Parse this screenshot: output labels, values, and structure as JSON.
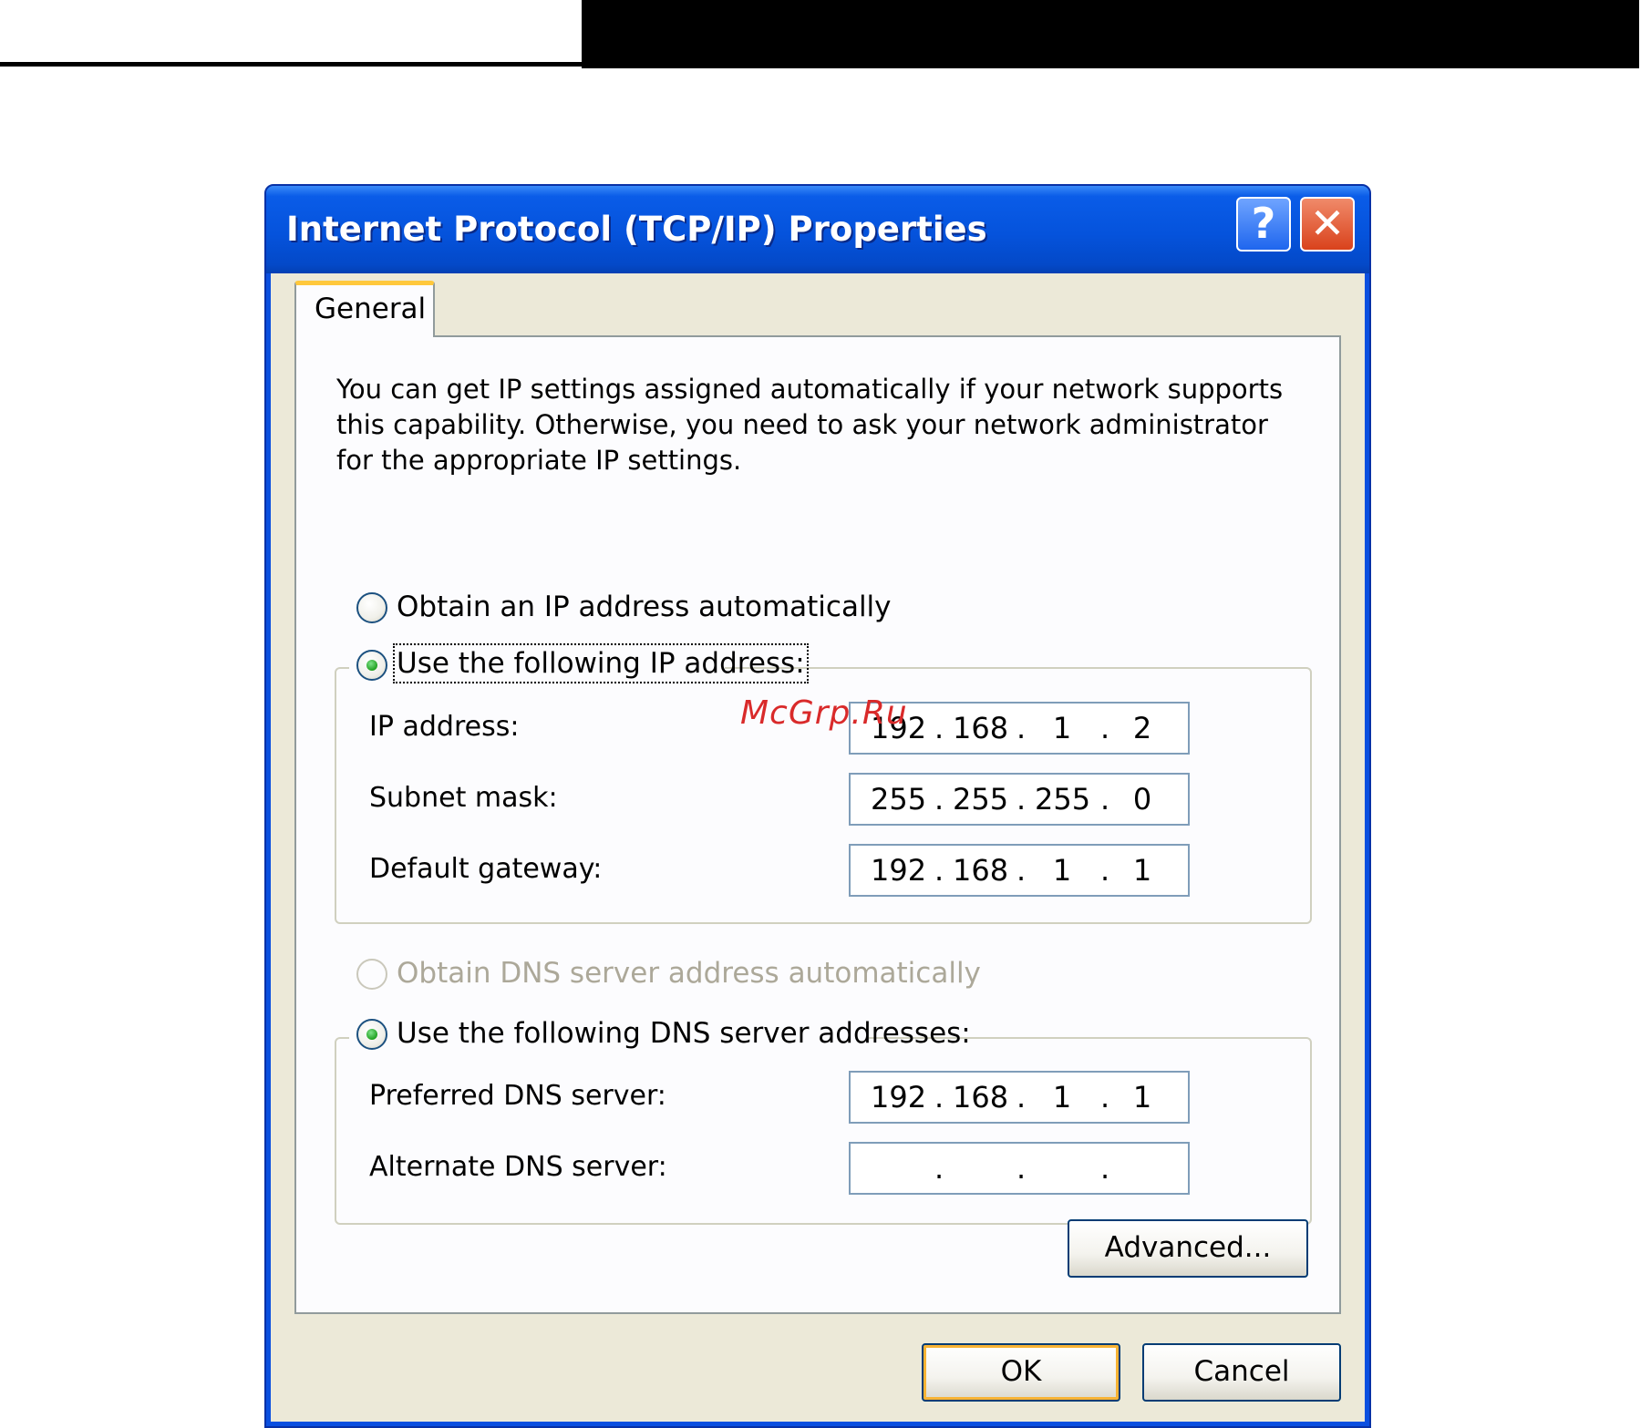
{
  "dialog": {
    "title": "Internet Protocol (TCP/IP) Properties",
    "help_button": "?",
    "close_button": "✕",
    "tab_label": "General",
    "intro_text": "You can get IP settings assigned automatically if your network supports this capability. Otherwise, you need to ask your network administrator for the appropriate IP settings."
  },
  "ip_section": {
    "auto_label": "Obtain an IP address automatically",
    "auto_checked": false,
    "manual_label": "Use the following IP address:",
    "manual_checked": true,
    "fields": {
      "ip_address": {
        "label": "IP address:",
        "octets": [
          "192",
          "168",
          "1",
          "2"
        ]
      },
      "subnet_mask": {
        "label": "Subnet mask:",
        "octets": [
          "255",
          "255",
          "255",
          "0"
        ]
      },
      "default_gateway": {
        "label": "Default gateway:",
        "octets": [
          "192",
          "168",
          "1",
          "1"
        ]
      }
    }
  },
  "dns_section": {
    "auto_label": "Obtain DNS server address automatically",
    "auto_enabled": false,
    "manual_label": "Use the following DNS server addresses:",
    "manual_checked": true,
    "fields": {
      "preferred": {
        "label": "Preferred DNS server:",
        "octets": [
          "192",
          "168",
          "1",
          "1"
        ]
      },
      "alternate": {
        "label": "Alternate DNS server:",
        "octets": [
          "",
          "",
          "",
          ""
        ]
      }
    }
  },
  "buttons": {
    "advanced": "Advanced...",
    "ok": "OK",
    "cancel": "Cancel"
  },
  "watermark": "McGrp.Ru",
  "colors": {
    "titlebar_blue": "#0553dc",
    "dialog_face": "#ece9d8",
    "radio_check_green": "#21a121",
    "default_button_accent": "#f8b334",
    "watermark_red": "#d92a2a"
  }
}
